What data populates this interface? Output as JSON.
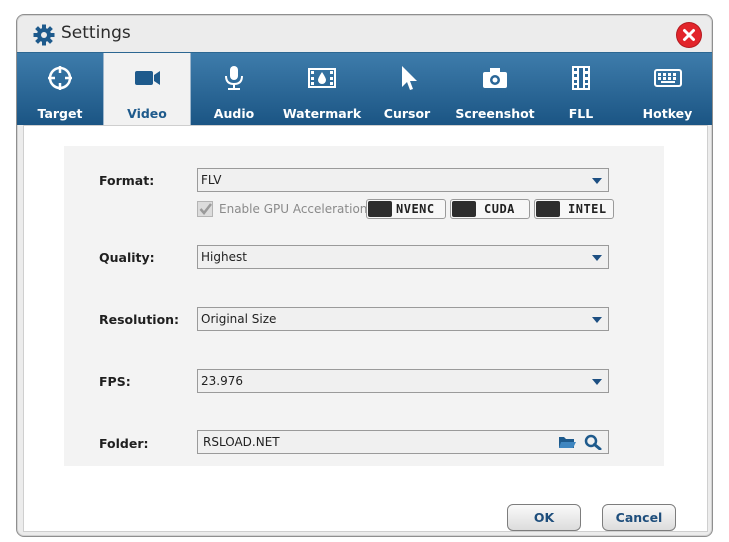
{
  "window": {
    "title": "Settings"
  },
  "tabs": [
    {
      "label": "Target",
      "icon": "target-icon"
    },
    {
      "label": "Video",
      "icon": "video-camera-icon",
      "active": true
    },
    {
      "label": "Audio",
      "icon": "microphone-icon"
    },
    {
      "label": "Watermark",
      "icon": "watermark-icon"
    },
    {
      "label": "Cursor",
      "icon": "cursor-icon"
    },
    {
      "label": "Screenshot",
      "icon": "camera-icon"
    },
    {
      "label": "FLL",
      "icon": "film-icon"
    },
    {
      "label": "Hotkey",
      "icon": "keyboard-icon"
    }
  ],
  "form": {
    "format": {
      "label": "Format:",
      "value": "FLV"
    },
    "gpu": {
      "label": "Enable GPU Acceleration",
      "checked": true,
      "badges": [
        "NVENC",
        "CUDA",
        "INTEL"
      ]
    },
    "quality": {
      "label": "Quality:",
      "value": "Highest"
    },
    "resolution": {
      "label": "Resolution:",
      "value": "Original Size"
    },
    "fps": {
      "label": "FPS:",
      "value": "23.976"
    },
    "folder": {
      "label": "Folder:",
      "value": "RSLOAD.NET"
    }
  },
  "buttons": {
    "ok": "OK",
    "cancel": "Cancel"
  },
  "colors": {
    "accent": "#1b5584",
    "close": "#e2252b"
  }
}
